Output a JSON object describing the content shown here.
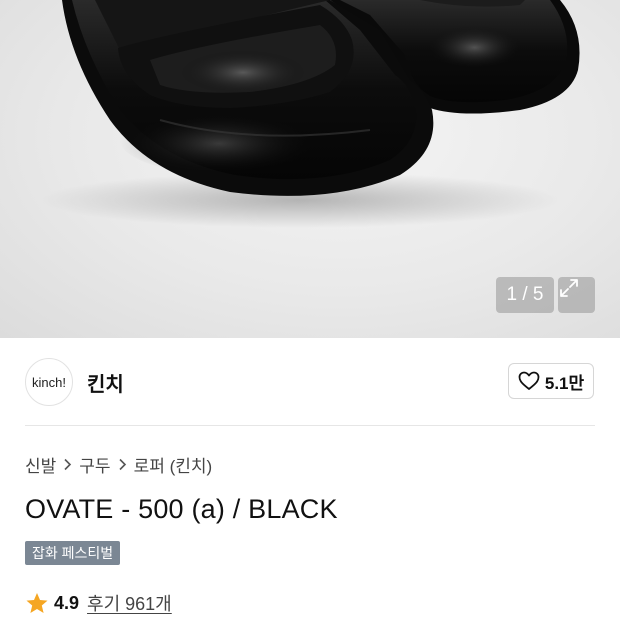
{
  "gallery": {
    "counter": "1 / 5",
    "expand_icon": "expand-icon"
  },
  "brand": {
    "logo_text": "kinch!",
    "name": "킨치",
    "likes": "5.1만",
    "like_icon": "heart-icon"
  },
  "breadcrumb": [
    "신발",
    "구두",
    "로퍼 (킨치)"
  ],
  "product": {
    "title": "OVATE - 500 (a) / BLACK",
    "tag": "잡화 페스티벌"
  },
  "rating": {
    "score": "4.9",
    "reviews": "후기 961개",
    "star_color": "#f5a623"
  }
}
